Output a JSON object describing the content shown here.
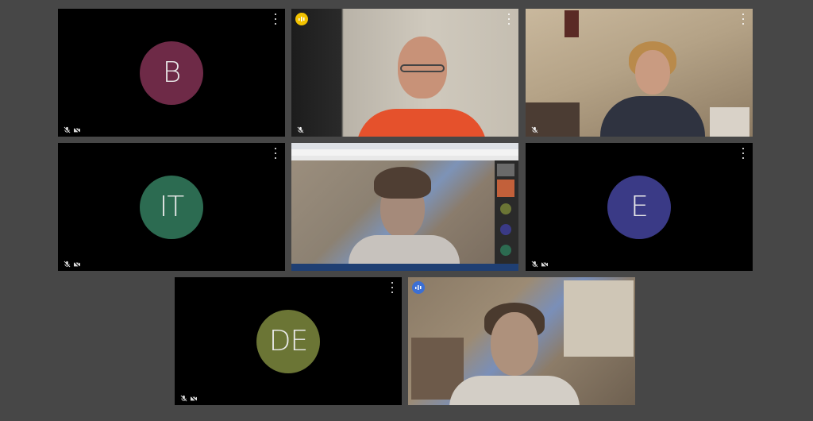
{
  "participants": [
    {
      "id": "b",
      "initials": "B",
      "avatar_color": "#6e2a47",
      "type": "avatar",
      "muted": true,
      "camera_off": true
    },
    {
      "id": "speaker-orange",
      "initials": "",
      "type": "video",
      "muted": true,
      "camera_off": false,
      "speaking": true,
      "speaking_color": "#f2c200"
    },
    {
      "id": "woman",
      "initials": "",
      "type": "video",
      "muted": true,
      "camera_off": false
    },
    {
      "id": "it",
      "initials": "IT",
      "avatar_color": "#2c6b51",
      "type": "avatar",
      "muted": true,
      "camera_off": true
    },
    {
      "id": "screen-share",
      "initials": "",
      "type": "screen",
      "muted": false,
      "camera_off": false
    },
    {
      "id": "e",
      "initials": "E",
      "avatar_color": "#3a3a86",
      "type": "avatar",
      "muted": true,
      "camera_off": true
    },
    {
      "id": "de",
      "initials": "DE",
      "avatar_color": "#6b7535",
      "type": "avatar",
      "muted": true,
      "camera_off": true
    },
    {
      "id": "self",
      "initials": "",
      "type": "video",
      "muted": false,
      "camera_off": false,
      "active": true,
      "active_color": "#3b6fd4"
    }
  ],
  "icons": {
    "more": "more-vert-icon",
    "mic_off": "mic-off-icon",
    "cam_off": "videocam-off-icon",
    "speaking": "speaking-indicator-icon"
  }
}
